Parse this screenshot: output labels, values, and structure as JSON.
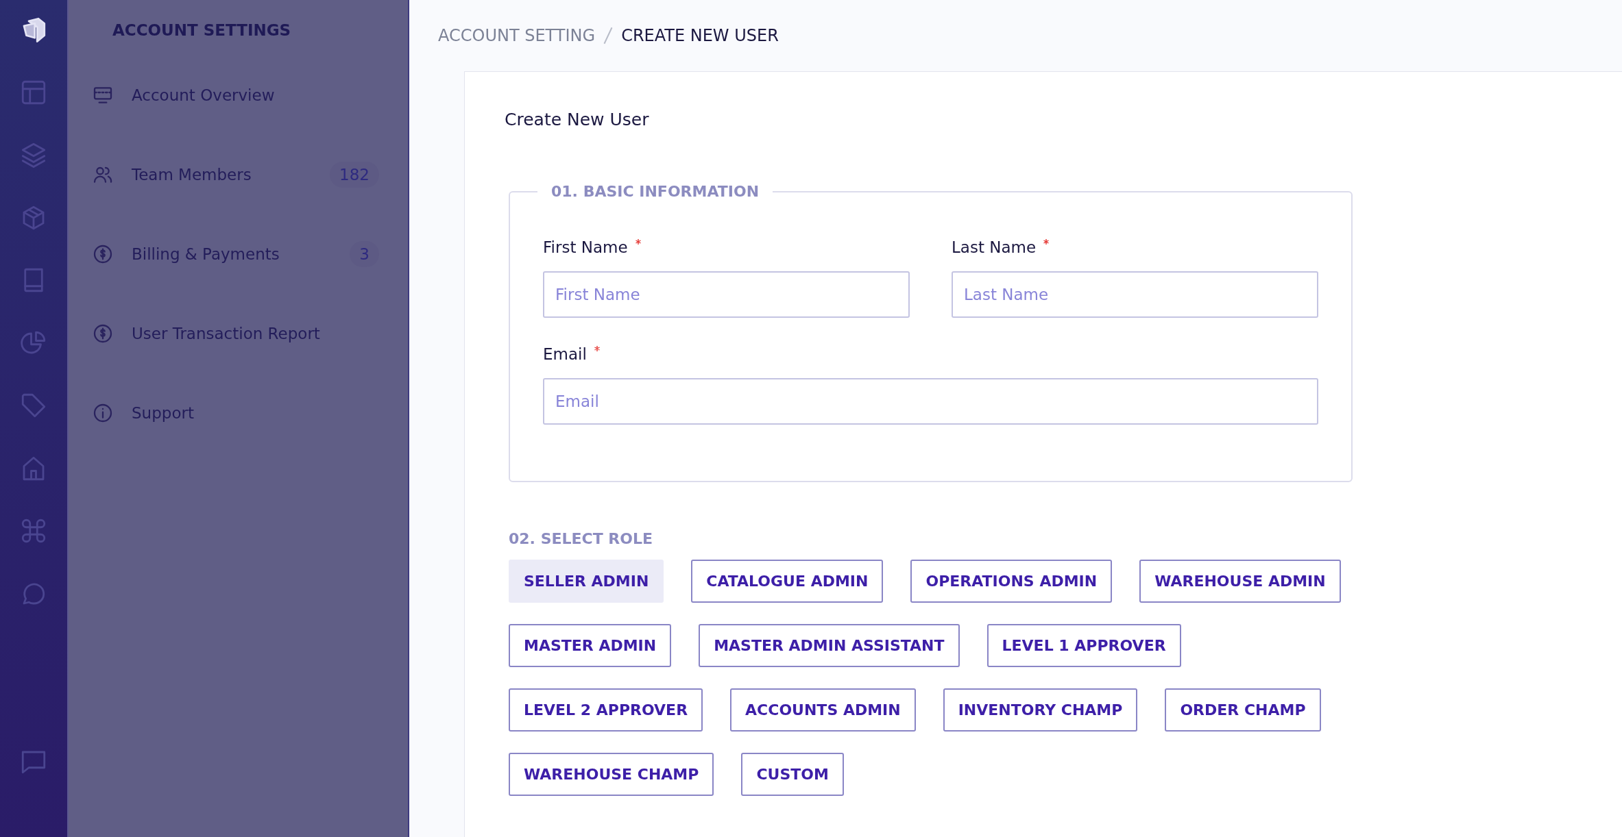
{
  "sidebar": {
    "title": "ACCOUNT SETTINGS",
    "items": [
      {
        "label": "Account Overview"
      },
      {
        "label": "Team Members",
        "count": "182"
      },
      {
        "label": "Billing & Payments",
        "count": "3"
      },
      {
        "label": "User Transaction Report"
      },
      {
        "label": "Support"
      }
    ]
  },
  "breadcrumb": [
    {
      "label": "ACCOUNT SETTING",
      "current": false
    },
    {
      "label": "CREATE NEW USER",
      "current": true
    }
  ],
  "card": {
    "title": "Create New User",
    "basic": {
      "legend": "01. BASIC INFORMATION",
      "fields": [
        {
          "label": "First Name",
          "required": true,
          "placeholder": "First Name",
          "wide": false
        },
        {
          "label": "Last Name",
          "required": true,
          "placeholder": "Last Name",
          "wide": false
        },
        {
          "label": "Email",
          "required": true,
          "placeholder": "Email",
          "wide": true
        }
      ]
    },
    "role": {
      "heading": "02. SELECT ROLE",
      "rows": [
        [
          {
            "label": "SELLER ADMIN",
            "selected": true
          },
          {
            "label": "CATALOGUE ADMIN",
            "selected": false
          },
          {
            "label": "OPERATIONS ADMIN",
            "selected": false
          },
          {
            "label": "WAREHOUSE ADMIN",
            "selected": false
          }
        ],
        [
          {
            "label": "MASTER ADMIN",
            "selected": false
          },
          {
            "label": "MASTER ADMIN ASSISTANT",
            "selected": false
          },
          {
            "label": "LEVEL 1 APPROVER",
            "selected": false
          }
        ],
        [
          {
            "label": "LEVEL 2 APPROVER",
            "selected": false
          },
          {
            "label": "ACCOUNTS ADMIN",
            "selected": false
          },
          {
            "label": "INVENTORY CHAMP",
            "selected": false
          },
          {
            "label": "ORDER CHAMP",
            "selected": false
          }
        ],
        [
          {
            "label": "WAREHOUSE CHAMP",
            "selected": false
          },
          {
            "label": "CUSTOM",
            "selected": false
          }
        ]
      ]
    }
  }
}
